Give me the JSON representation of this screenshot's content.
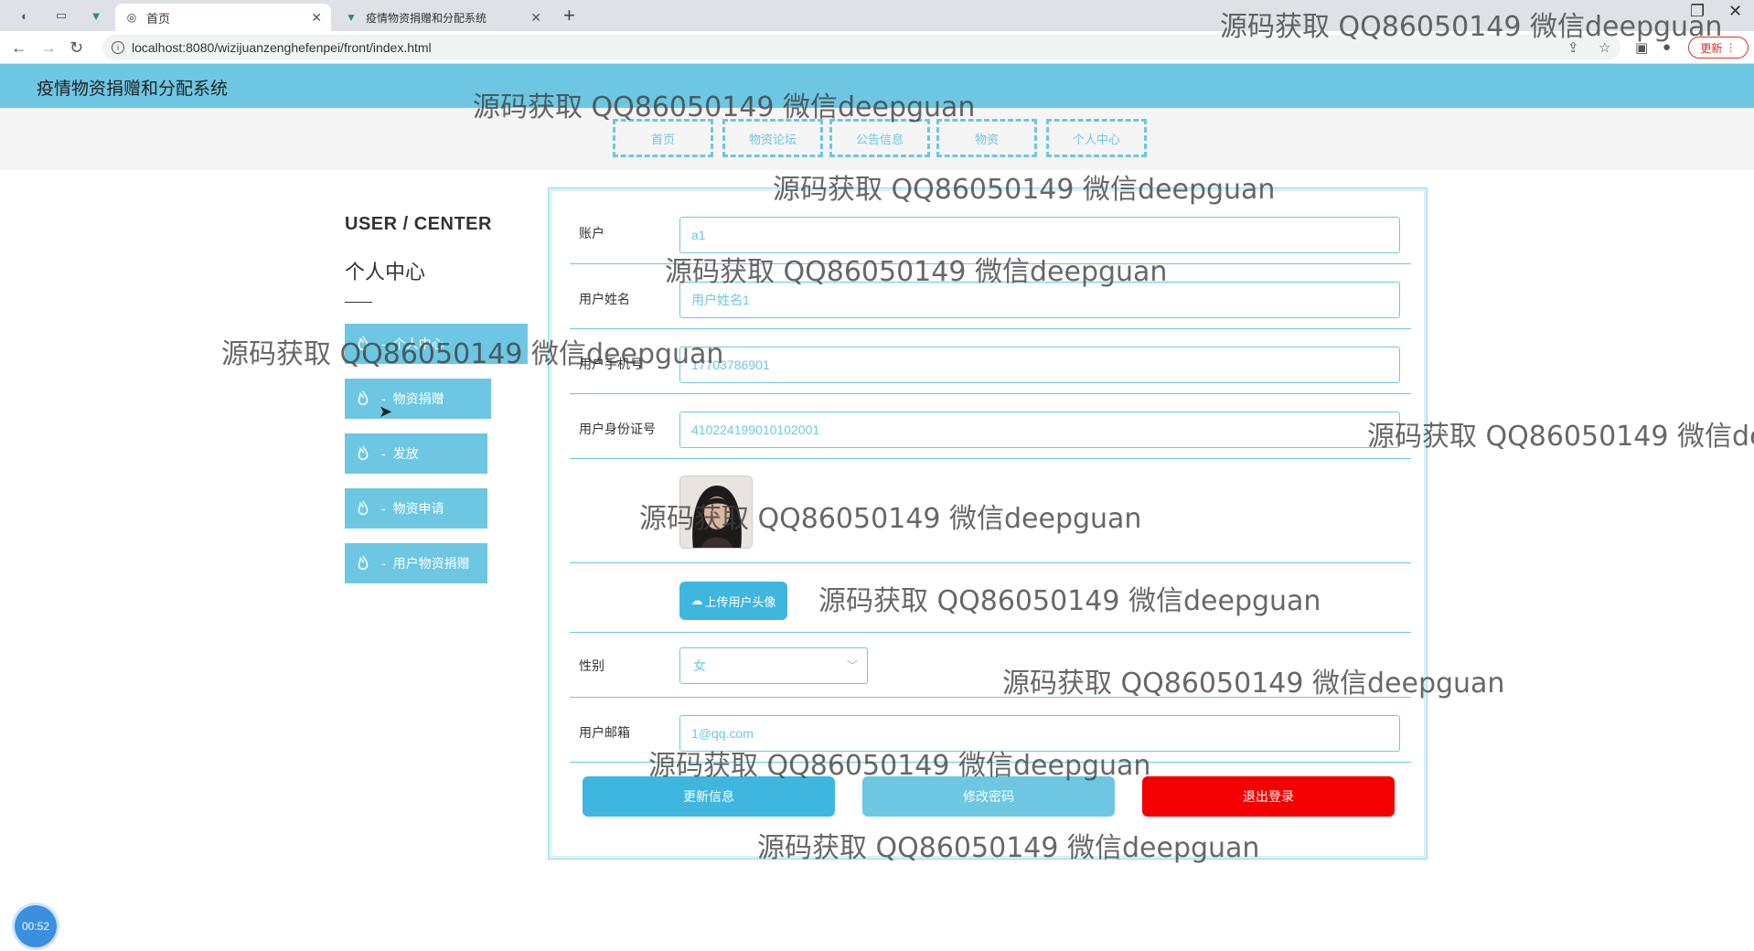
{
  "browser": {
    "tabs": [
      {
        "label": "首页",
        "active": true
      },
      {
        "label": "疫情物资捐赠和分配系统",
        "active": false
      }
    ],
    "url": "localhost:8080/wizijuanzenghefenpei/front/index.html",
    "update_label": "更新"
  },
  "site": {
    "title": "疫情物资捐赠和分配系统",
    "nav": [
      "首页",
      "物资论坛",
      "公告信息",
      "物资",
      "个人中心"
    ]
  },
  "sidebar": {
    "title_en": "USER / CENTER",
    "title_cn": "个人中心",
    "items": [
      {
        "label": "个人中心"
      },
      {
        "label": "物资捐赠"
      },
      {
        "label": "发放"
      },
      {
        "label": "物资申请"
      },
      {
        "label": "用户物资捐赠"
      }
    ]
  },
  "form": {
    "account": {
      "label": "账户",
      "value": "a1"
    },
    "name": {
      "label": "用户姓名",
      "value": "用户姓名1"
    },
    "phone": {
      "label": "用户手机号",
      "value": "17703786901"
    },
    "idcard": {
      "label": "用户身份证号",
      "value": "410224199010102001"
    },
    "upload_label": "上传用户头像",
    "gender": {
      "label": "性别",
      "value": "女"
    },
    "email": {
      "label": "用户邮箱",
      "value": "1@qq.com"
    },
    "buttons": {
      "update": "更新信息",
      "change_password": "修改密码",
      "logout": "退出登录"
    }
  },
  "watermark": "源码获取 QQ86050149 微信deepguan",
  "timer": "00:52",
  "colors": {
    "accent": "#6dc7e2",
    "button_blue": "#3fb6e0",
    "logout_red": "#f50000"
  }
}
